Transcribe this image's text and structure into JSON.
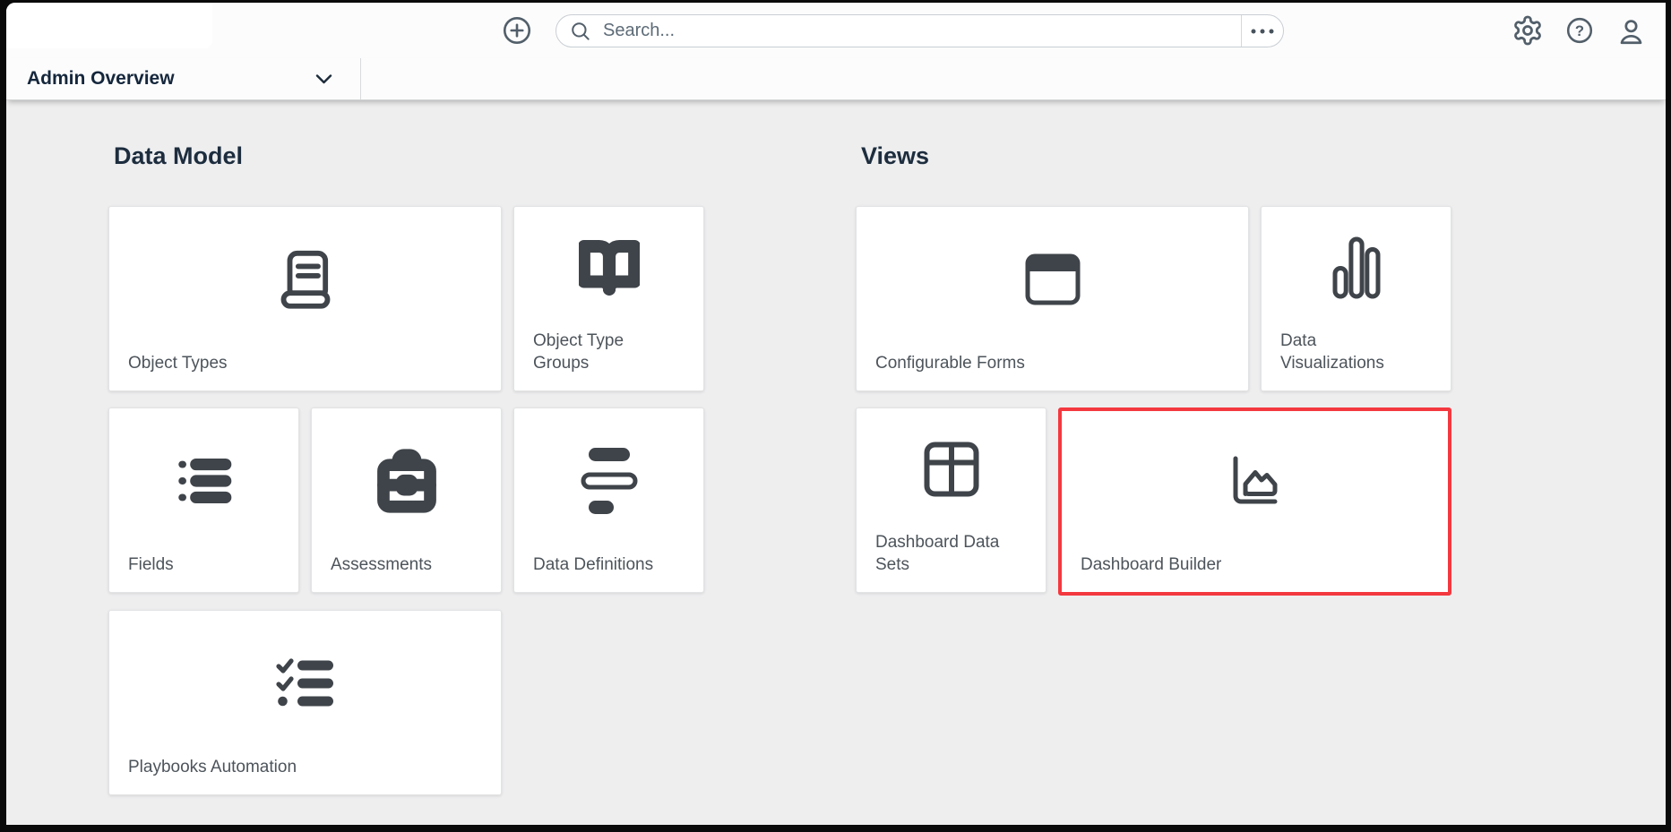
{
  "header": {
    "search": {
      "placeholder": "Search..."
    },
    "icons": [
      "plus-circle-icon",
      "search-icon",
      "ellipsis-icon",
      "gear-icon",
      "help-icon",
      "user-icon"
    ]
  },
  "nav": {
    "selected_view": "Admin Overview",
    "chevron_icon": "chevron-down-icon"
  },
  "sections": [
    {
      "title": "Data Model",
      "tiles": [
        {
          "label": "Object Types",
          "icon": "book-text-icon"
        },
        {
          "label": "Object Type Groups",
          "icon": "book-open-icon"
        },
        {
          "label": "Fields",
          "icon": "list-icon"
        },
        {
          "label": "Assessments",
          "icon": "briefcase-icon"
        },
        {
          "label": "Data Definitions",
          "icon": "data-bars-icon"
        },
        {
          "label": "Playbooks Automation",
          "icon": "checklist-icon"
        }
      ]
    },
    {
      "title": "Views",
      "tiles": [
        {
          "label": "Configurable Forms",
          "icon": "window-icon"
        },
        {
          "label": "Data Visualizations",
          "icon": "bar-chart-icon"
        },
        {
          "label": "Dashboard Data Sets",
          "icon": "table-grid-icon"
        },
        {
          "label": "Dashboard Builder",
          "icon": "area-chart-icon",
          "highlighted": true
        }
      ]
    }
  ],
  "colors": {
    "highlight_red": "#f4383f",
    "icon_dark": "#3f444a",
    "heading": "#1d2d3e",
    "tile_label": "#4d545b",
    "topbar_icon": "#525f6a",
    "content_background": "#eeeeef",
    "bar_background": "#fcfcfc",
    "frame_black": "#000000"
  }
}
